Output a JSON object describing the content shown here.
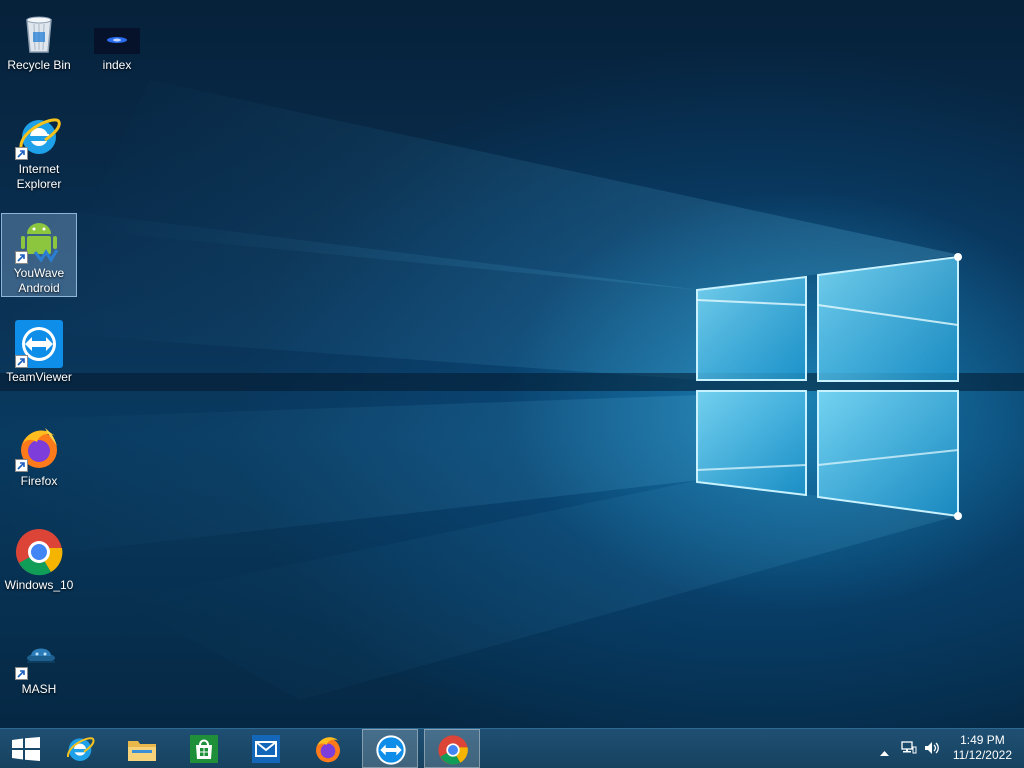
{
  "desktop": {
    "icons": [
      {
        "label": "Recycle Bin",
        "icon": "recycle-bin-icon"
      },
      {
        "label": "index",
        "icon": "index-thumbnail-icon"
      },
      {
        "label": "Internet Explorer",
        "icon": "internet-explorer-icon"
      },
      {
        "label": "YouWave Android",
        "icon": "android-icon"
      },
      {
        "label": "TeamViewer",
        "icon": "teamviewer-icon"
      },
      {
        "label": "Firefox",
        "icon": "firefox-icon"
      },
      {
        "label": "Windows_10",
        "icon": "chrome-icon"
      },
      {
        "label": "MASH",
        "icon": "mash-icon"
      }
    ],
    "selected_icon": "YouWave Android"
  },
  "taskbar": {
    "buttons": [
      {
        "name": "start",
        "icon": "windows-logo-icon"
      },
      {
        "name": "internet-explorer",
        "icon": "internet-explorer-icon"
      },
      {
        "name": "file-explorer",
        "icon": "folder-icon"
      },
      {
        "name": "store",
        "icon": "store-icon"
      },
      {
        "name": "mail",
        "icon": "mail-icon"
      },
      {
        "name": "firefox",
        "icon": "firefox-icon"
      },
      {
        "name": "teamviewer",
        "icon": "teamviewer-icon",
        "active": true
      },
      {
        "name": "chrome",
        "icon": "chrome-icon",
        "active": true
      }
    ],
    "tray": {
      "icons": [
        "chevron-up-icon",
        "network-icon",
        "volume-icon"
      ],
      "time": "1:49 PM",
      "date": "11/12/2022"
    }
  },
  "colors": {
    "taskbar": "#1a4868",
    "desktop_base": "#0a3357",
    "accent_blue": "#0e8ee9",
    "selection": "#9bbfe6"
  }
}
